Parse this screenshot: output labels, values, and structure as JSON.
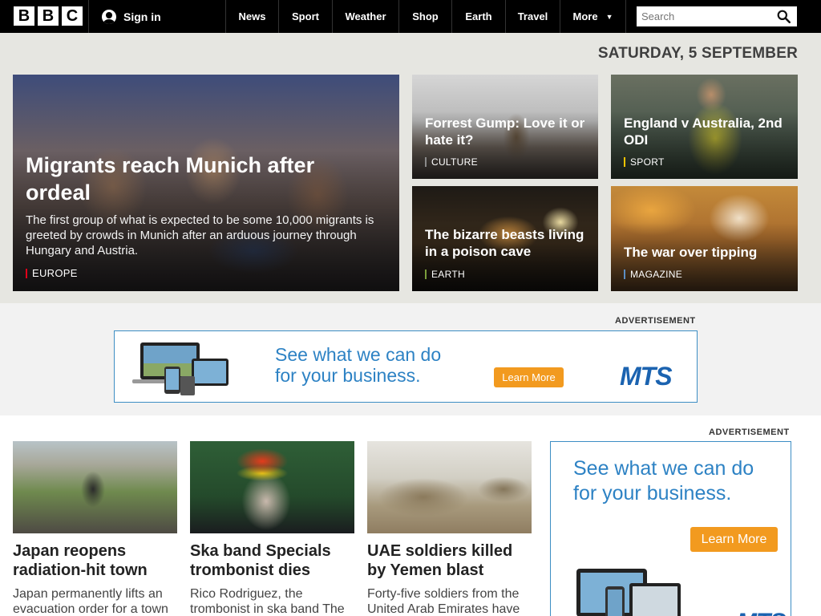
{
  "header": {
    "logo_letters": [
      "B",
      "B",
      "C"
    ],
    "signin_label": "Sign in",
    "nav": [
      "News",
      "Sport",
      "Weather",
      "Shop",
      "Earth",
      "Travel",
      "More"
    ],
    "search_placeholder": "Search"
  },
  "date": "SATURDAY, 5 SEPTEMBER",
  "hero": {
    "main": {
      "title": "Migrants reach Munich after ordeal",
      "summary": "The first group of what is expected to be some 10,000 migrants is greeted by crowds in Munich after an arduous journey through Hungary and Austria.",
      "tag": "EUROPE"
    },
    "tiles": [
      {
        "title": "Forrest Gump: Love it or hate it?",
        "tag": "CULTURE",
        "tag_color": "#8a8a8a"
      },
      {
        "title": "England v Australia, 2nd ODI",
        "tag": "SPORT",
        "tag_color": "#f5c400"
      },
      {
        "title": "The bizarre beasts living in a poison cave",
        "tag": "EARTH",
        "tag_color": "#7a9e3b"
      },
      {
        "title": "The war over tipping",
        "tag": "MAGAZINE",
        "tag_color": "#5b8dc2"
      }
    ]
  },
  "ads": {
    "label": "ADVERTISEMENT",
    "line1": "See what we can do",
    "line2": "for your business.",
    "cta_leader": "Learn More",
    "cta_mpu": "Learn More",
    "brand": "MTS"
  },
  "stories": [
    {
      "title": "Japan reopens radiation-hit town",
      "summary": "Japan permanently lifts an evacuation order for a town"
    },
    {
      "title": "Ska band Specials trombonist dies",
      "summary": "Rico Rodriguez, the trombonist in ska band The"
    },
    {
      "title": "UAE soldiers killed by Yemen blast",
      "summary": "Forty-five soldiers from the United Arab Emirates have"
    }
  ],
  "colors": {
    "topbar": "#000000",
    "hero_bg": "#e6e6e1",
    "europe_tag": "#e1001a",
    "ad_blue": "#2d82c4",
    "ad_orange": "#f29a1f"
  }
}
